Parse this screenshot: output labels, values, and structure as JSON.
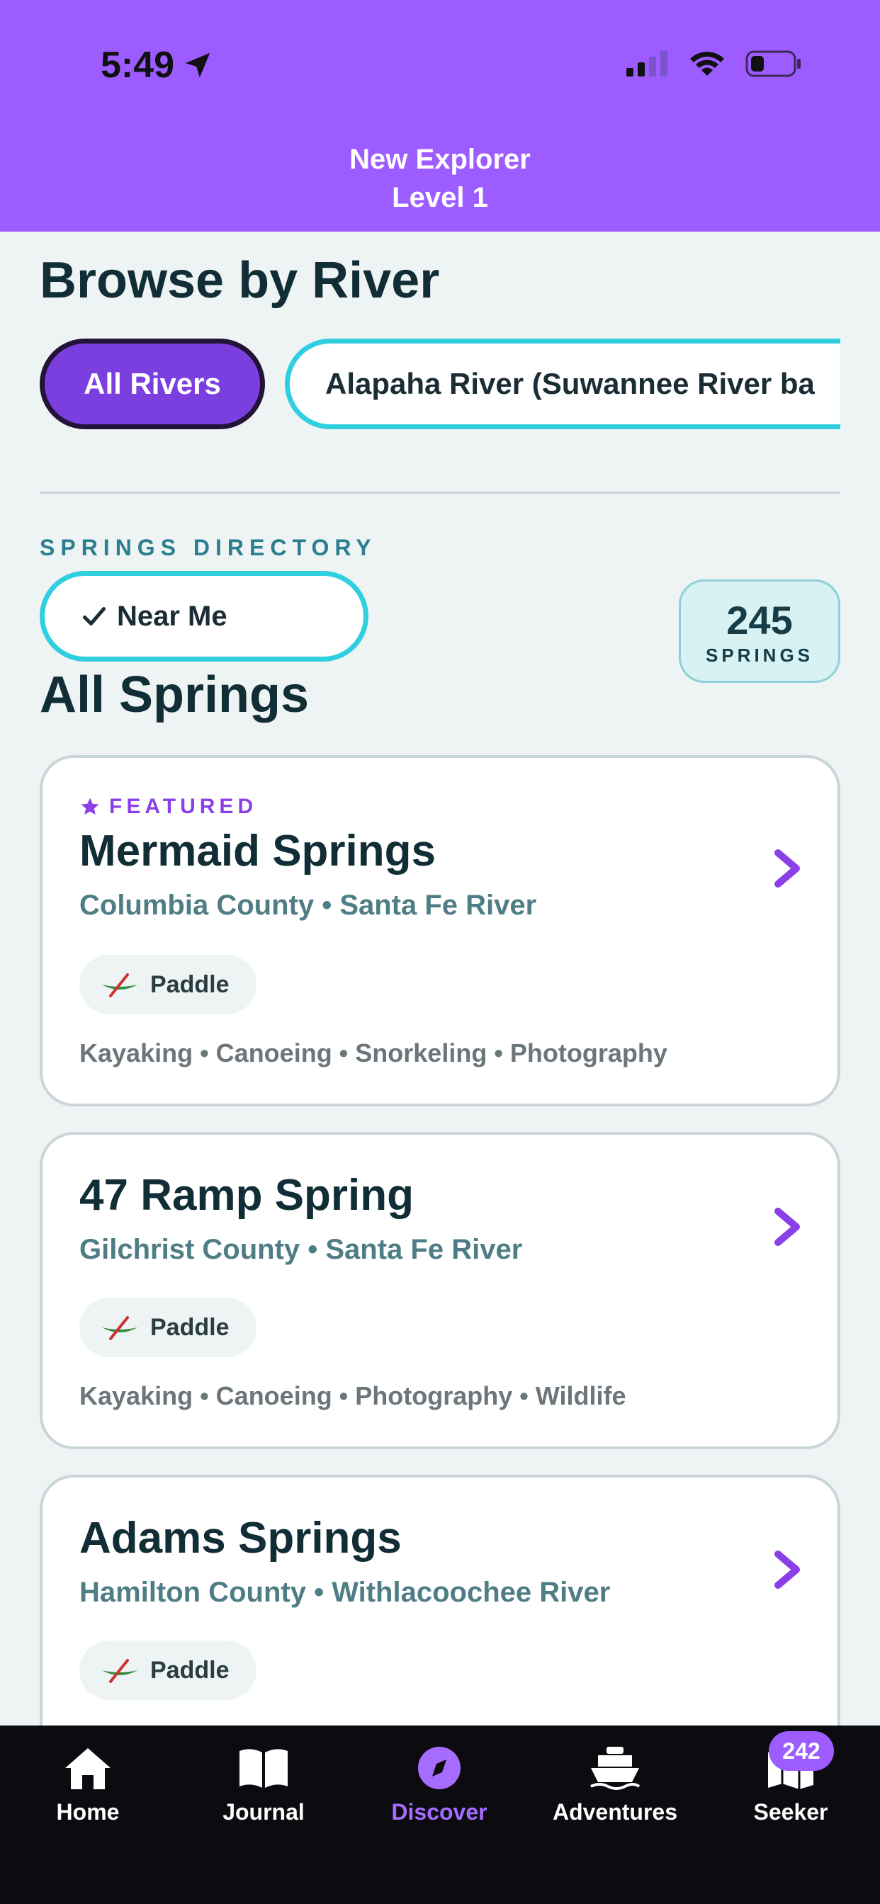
{
  "status": {
    "time": "5:49"
  },
  "header": {
    "line1": "New Explorer",
    "line2": "Level 1"
  },
  "browse": {
    "title": "Browse by River",
    "chips": [
      "All Rivers",
      "Alapaha River (Suwannee River ba"
    ]
  },
  "directory": {
    "label": "SPRINGS DIRECTORY",
    "near_me": "Near Me",
    "count": "245",
    "count_label": "SPRINGS",
    "title": "All Springs"
  },
  "springs": [
    {
      "featured": "FEATURED",
      "name": "Mermaid Springs",
      "location": "Columbia County • Santa Fe River",
      "tag": "Paddle",
      "activities": "Kayaking  •  Canoeing  •  Snorkeling  •  Photography"
    },
    {
      "name": "47 Ramp Spring",
      "location": "Gilchrist County • Santa Fe River",
      "tag": "Paddle",
      "activities": "Kayaking  •  Canoeing  •  Photography  •  Wildlife"
    },
    {
      "name": "Adams Springs",
      "location": "Hamilton County • Withlacoochee River",
      "tag": "Paddle"
    }
  ],
  "tabs": [
    {
      "label": "Home",
      "icon": "home-icon"
    },
    {
      "label": "Journal",
      "icon": "book-icon"
    },
    {
      "label": "Discover",
      "icon": "compass-icon",
      "active": true
    },
    {
      "label": "Adventures",
      "icon": "boat-icon"
    },
    {
      "label": "Seeker",
      "icon": "map-icon",
      "badge": "242"
    }
  ],
  "colors": {
    "header": "#9d5cff",
    "accent": "#7b3fe0",
    "cyan": "#2fcfe0",
    "tabbar": "#0b0b10"
  }
}
